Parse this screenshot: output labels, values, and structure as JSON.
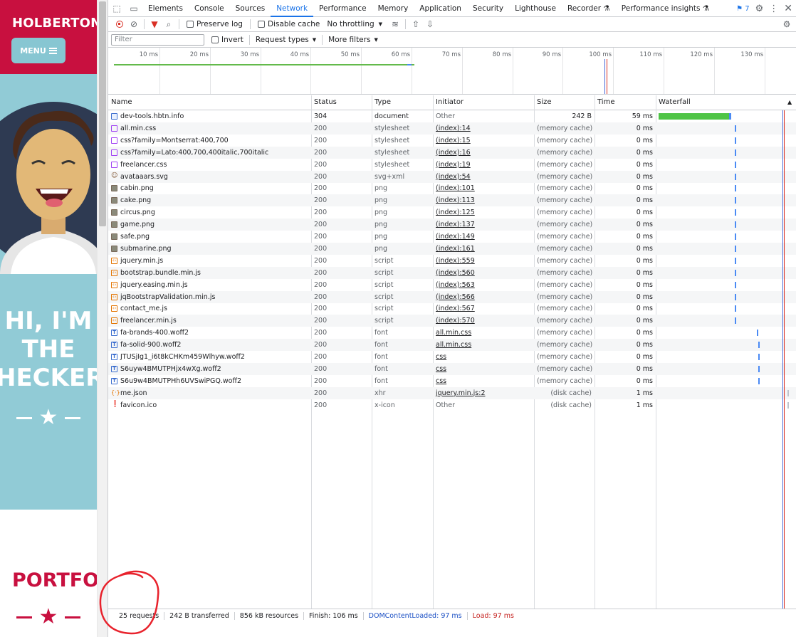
{
  "site": {
    "brand": "HOLBERTON",
    "menu_label": "MENU",
    "hero_lines": [
      "HI, I'M",
      "THE",
      "HECKER"
    ],
    "portfolio_heading": "PORTFOLIO",
    "colors": {
      "primary": "#c8103f",
      "hero_bg": "#91cbd6"
    }
  },
  "devtools": {
    "tabs": [
      "Elements",
      "Console",
      "Sources",
      "Network",
      "Performance",
      "Memory",
      "Application",
      "Security",
      "Lighthouse",
      "Recorder",
      "Performance insights"
    ],
    "active_tab": "Network",
    "issues_count": "7",
    "toolbar": {
      "preserve_log": "Preserve log",
      "disable_cache": "Disable cache",
      "throttling": "No throttling"
    },
    "filter": {
      "placeholder": "Filter",
      "invert": "Invert",
      "request_types": "Request types",
      "more_filters": "More filters"
    },
    "overview_ticks": [
      "10 ms",
      "20 ms",
      "30 ms",
      "40 ms",
      "50 ms",
      "60 ms",
      "70 ms",
      "80 ms",
      "90 ms",
      "100 ms",
      "110 ms",
      "120 ms",
      "130 ms"
    ],
    "columns": {
      "name": "Name",
      "status": "Status",
      "type": "Type",
      "initiator": "Initiator",
      "size": "Size",
      "time": "Time",
      "waterfall": "Waterfall"
    },
    "requests": [
      {
        "icon": "document-icon",
        "name": "dev-tools.hbtn.info",
        "status": "304",
        "type": "document",
        "initiator": "Other",
        "size": "242 B",
        "time": "59 ms",
        "wf_start": 0,
        "wf_ms": 59
      },
      {
        "icon": "stylesheet-icon",
        "name": "all.min.css",
        "status": "200",
        "type": "stylesheet",
        "initiator": "(index):14",
        "size": "(memory cache)",
        "time": "0 ms",
        "wf_start": 62,
        "wf_ms": 0
      },
      {
        "icon": "stylesheet-icon",
        "name": "css?family=Montserrat:400,700",
        "status": "200",
        "type": "stylesheet",
        "initiator": "(index):15",
        "size": "(memory cache)",
        "time": "0 ms",
        "wf_start": 62,
        "wf_ms": 0
      },
      {
        "icon": "stylesheet-icon",
        "name": "css?family=Lato:400,700,400italic,700italic",
        "status": "200",
        "type": "stylesheet",
        "initiator": "(index):16",
        "size": "(memory cache)",
        "time": "0 ms",
        "wf_start": 62,
        "wf_ms": 0
      },
      {
        "icon": "stylesheet-icon",
        "name": "freelancer.css",
        "status": "200",
        "type": "stylesheet",
        "initiator": "(index):19",
        "size": "(memory cache)",
        "time": "0 ms",
        "wf_start": 62,
        "wf_ms": 0
      },
      {
        "icon": "svg-image-icon",
        "name": "avataaars.svg",
        "status": "200",
        "type": "svg+xml",
        "initiator": "(index):54",
        "size": "(memory cache)",
        "time": "0 ms",
        "wf_start": 62,
        "wf_ms": 0
      },
      {
        "icon": "image-icon",
        "name": "cabin.png",
        "status": "200",
        "type": "png",
        "initiator": "(index):101",
        "size": "(memory cache)",
        "time": "0 ms",
        "wf_start": 62,
        "wf_ms": 0
      },
      {
        "icon": "image-icon",
        "name": "cake.png",
        "status": "200",
        "type": "png",
        "initiator": "(index):113",
        "size": "(memory cache)",
        "time": "0 ms",
        "wf_start": 62,
        "wf_ms": 0
      },
      {
        "icon": "image-icon",
        "name": "circus.png",
        "status": "200",
        "type": "png",
        "initiator": "(index):125",
        "size": "(memory cache)",
        "time": "0 ms",
        "wf_start": 62,
        "wf_ms": 0
      },
      {
        "icon": "image-icon",
        "name": "game.png",
        "status": "200",
        "type": "png",
        "initiator": "(index):137",
        "size": "(memory cache)",
        "time": "0 ms",
        "wf_start": 62,
        "wf_ms": 0
      },
      {
        "icon": "image-icon",
        "name": "safe.png",
        "status": "200",
        "type": "png",
        "initiator": "(index):149",
        "size": "(memory cache)",
        "time": "0 ms",
        "wf_start": 62,
        "wf_ms": 0
      },
      {
        "icon": "image-icon",
        "name": "submarine.png",
        "status": "200",
        "type": "png",
        "initiator": "(index):161",
        "size": "(memory cache)",
        "time": "0 ms",
        "wf_start": 62,
        "wf_ms": 0
      },
      {
        "icon": "script-icon",
        "name": "jquery.min.js",
        "status": "200",
        "type": "script",
        "initiator": "(index):559",
        "size": "(memory cache)",
        "time": "0 ms",
        "wf_start": 62,
        "wf_ms": 0
      },
      {
        "icon": "script-icon",
        "name": "bootstrap.bundle.min.js",
        "status": "200",
        "type": "script",
        "initiator": "(index):560",
        "size": "(memory cache)",
        "time": "0 ms",
        "wf_start": 62,
        "wf_ms": 0
      },
      {
        "icon": "script-icon",
        "name": "jquery.easing.min.js",
        "status": "200",
        "type": "script",
        "initiator": "(index):563",
        "size": "(memory cache)",
        "time": "0 ms",
        "wf_start": 62,
        "wf_ms": 0
      },
      {
        "icon": "script-icon",
        "name": "jqBootstrapValidation.min.js",
        "status": "200",
        "type": "script",
        "initiator": "(index):566",
        "size": "(memory cache)",
        "time": "0 ms",
        "wf_start": 62,
        "wf_ms": 0
      },
      {
        "icon": "script-icon",
        "name": "contact_me.js",
        "status": "200",
        "type": "script",
        "initiator": "(index):567",
        "size": "(memory cache)",
        "time": "0 ms",
        "wf_start": 62,
        "wf_ms": 0
      },
      {
        "icon": "script-icon",
        "name": "freelancer.min.js",
        "status": "200",
        "type": "script",
        "initiator": "(index):570",
        "size": "(memory cache)",
        "time": "0 ms",
        "wf_start": 62,
        "wf_ms": 0
      },
      {
        "icon": "font-icon",
        "name": "fa-brands-400.woff2",
        "status": "200",
        "type": "font",
        "initiator": "all.min.css",
        "size": "(memory cache)",
        "time": "0 ms",
        "wf_start": 80,
        "wf_ms": 0
      },
      {
        "icon": "font-icon",
        "name": "fa-solid-900.woff2",
        "status": "200",
        "type": "font",
        "initiator": "all.min.css",
        "size": "(memory cache)",
        "time": "0 ms",
        "wf_start": 81,
        "wf_ms": 0
      },
      {
        "icon": "font-icon",
        "name": "JTUSjIg1_i6t8kCHKm459Wlhyw.woff2",
        "status": "200",
        "type": "font",
        "initiator": "css",
        "size": "(memory cache)",
        "time": "0 ms",
        "wf_start": 81,
        "wf_ms": 0
      },
      {
        "icon": "font-icon",
        "name": "S6uyw4BMUTPHjx4wXg.woff2",
        "status": "200",
        "type": "font",
        "initiator": "css",
        "size": "(memory cache)",
        "time": "0 ms",
        "wf_start": 81,
        "wf_ms": 0
      },
      {
        "icon": "font-icon",
        "name": "S6u9w4BMUTPHh6UVSwiPGQ.woff2",
        "status": "200",
        "type": "font",
        "initiator": "css",
        "size": "(memory cache)",
        "time": "0 ms",
        "wf_start": 81,
        "wf_ms": 0
      },
      {
        "icon": "xhr-icon",
        "name": "me.json",
        "status": "200",
        "type": "xhr",
        "initiator": "jquery.min.js:2",
        "size": "(disk cache)",
        "time": "1 ms",
        "wf_start": 105,
        "wf_ms": 1
      },
      {
        "icon": "favicon-icon",
        "name": "favicon.ico",
        "status": "200",
        "type": "x-icon",
        "initiator": "Other",
        "size": "(disk cache)",
        "time": "1 ms",
        "wf_start": 105,
        "wf_ms": 1
      }
    ],
    "status_bar": {
      "requests": "25 requests",
      "transferred": "242 B transferred",
      "resources": "856 kB resources",
      "finish": "Finish: 106 ms",
      "dom_content_loaded": "DOMContentLoaded: 97 ms",
      "load": "Load: 97 ms"
    },
    "colors": {
      "accent": "#1a73e8",
      "waterfall_green": "#4fc446",
      "waterfall_blue": "#4a8af4",
      "dcl": "#1a4fc4",
      "load": "#c5221f"
    }
  }
}
